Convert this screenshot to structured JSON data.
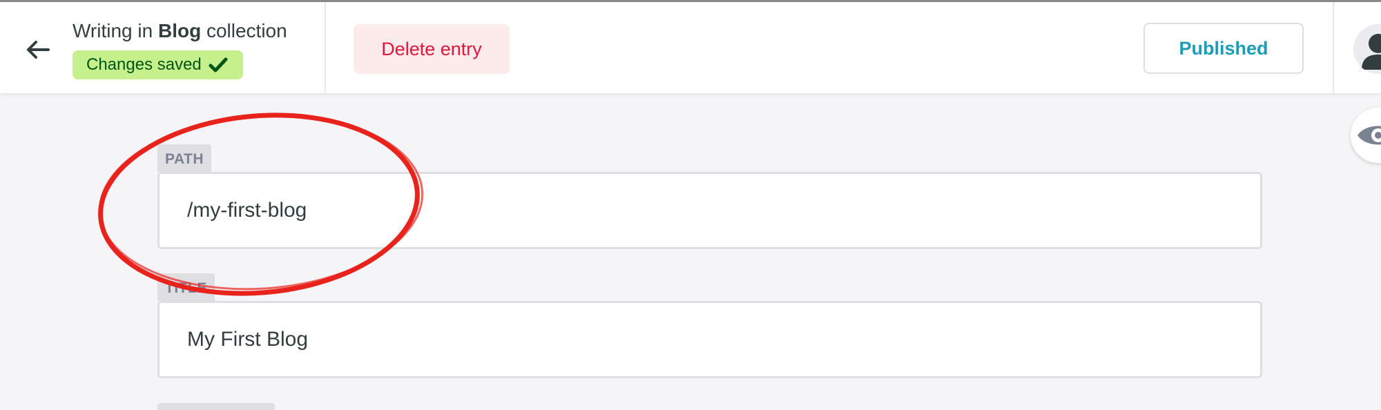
{
  "header": {
    "collection_prefix": "Writing in",
    "collection_name": "Blog",
    "collection_suffix": "collection",
    "saved_status": "Changes saved",
    "delete_label": "Delete entry",
    "publish_status": "Published"
  },
  "fields": [
    {
      "label": "PATH",
      "value": "/my-first-blog"
    },
    {
      "label": "TITLE",
      "value": "My First Blog"
    }
  ],
  "icons": {
    "back": "arrow-left-icon",
    "saved": "checkmark-icon",
    "avatar": "user-icon",
    "preview": "eye-icon"
  },
  "colors": {
    "saved_badge_bg": "#c6f08c",
    "saved_badge_text": "#005614",
    "delete_text": "#e0163f",
    "delete_bg": "#fdeaea",
    "published_text": "#1b9db5",
    "annotation": "#e8231c"
  }
}
